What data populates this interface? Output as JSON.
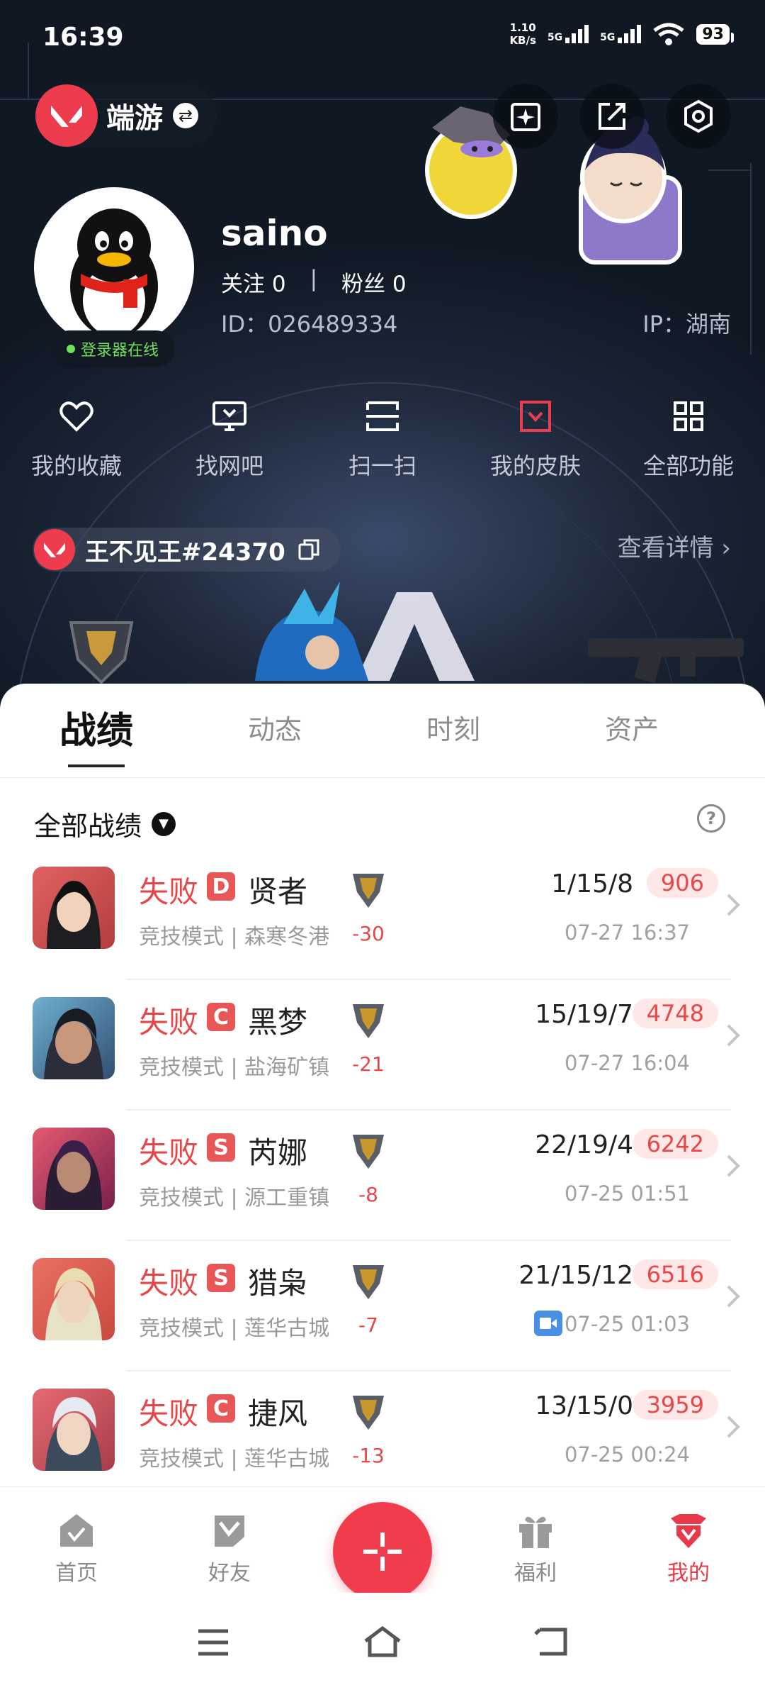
{
  "status_bar": {
    "time": "16:39",
    "speed_value": "1.10",
    "speed_unit": "KB/s",
    "sim1": "5G",
    "sim2": "5G",
    "battery": "93"
  },
  "header": {
    "app_name": "端游"
  },
  "profile": {
    "nickname": "saino",
    "following": "关注 0",
    "followers": "粉丝 0",
    "separator": "|",
    "id": "ID：026489334",
    "ip": "IP：湖南",
    "online_status": "登录器在线"
  },
  "menu": [
    {
      "label": "我的收藏",
      "icon": "heart-icon"
    },
    {
      "label": "找网吧",
      "icon": "monitor-icon"
    },
    {
      "label": "扫一扫",
      "icon": "scan-icon"
    },
    {
      "label": "我的皮肤",
      "icon": "skin-icon"
    },
    {
      "label": "全部功能",
      "icon": "grid-icon"
    }
  ],
  "game_account": {
    "name": "王不见王#24370",
    "details": "查看详情"
  },
  "tabs": [
    "战绩",
    "动态",
    "时刻",
    "资产"
  ],
  "filter": {
    "label": "全部战绩"
  },
  "matches": [
    {
      "result": "失败",
      "grade": "D",
      "agent": "贤者",
      "mode": "竞技模式 | 森寒冬港",
      "rr": "-30",
      "kda": "1/15/8",
      "score": "906",
      "date": "07-27 16:37",
      "video": false
    },
    {
      "result": "失败",
      "grade": "C",
      "agent": "黑梦",
      "mode": "竞技模式 | 盐海矿镇",
      "rr": "-21",
      "kda": "15/19/7",
      "score": "4748",
      "date": "07-27 16:04",
      "video": false
    },
    {
      "result": "失败",
      "grade": "S",
      "agent": "芮娜",
      "mode": "竞技模式 | 源工重镇",
      "rr": "-8",
      "kda": "22/19/4",
      "score": "6242",
      "date": "07-25 01:51",
      "video": false
    },
    {
      "result": "失败",
      "grade": "S",
      "agent": "猎枭",
      "mode": "竞技模式 | 莲华古城",
      "rr": "-7",
      "kda": "21/15/12",
      "score": "6516",
      "date": "07-25 01:03",
      "video": true
    },
    {
      "result": "失败",
      "grade": "C",
      "agent": "捷风",
      "mode": "竞技模式 | 莲华古城",
      "rr": "-13",
      "kda": "13/15/0",
      "score": "3959",
      "date": "07-25 00:24",
      "video": false
    }
  ],
  "bottom_nav": [
    {
      "label": "首页",
      "icon": "home-icon"
    },
    {
      "label": "好友",
      "icon": "friends-icon"
    },
    {
      "label": "福利",
      "icon": "gift-icon"
    },
    {
      "label": "我的",
      "icon": "profile-icon"
    }
  ],
  "colors": {
    "accent": "#ec3c4d",
    "loss": "#e8474a",
    "score_bg": "#fde7e7",
    "grade_bg": "#e85757",
    "online": "#6fe05a"
  }
}
